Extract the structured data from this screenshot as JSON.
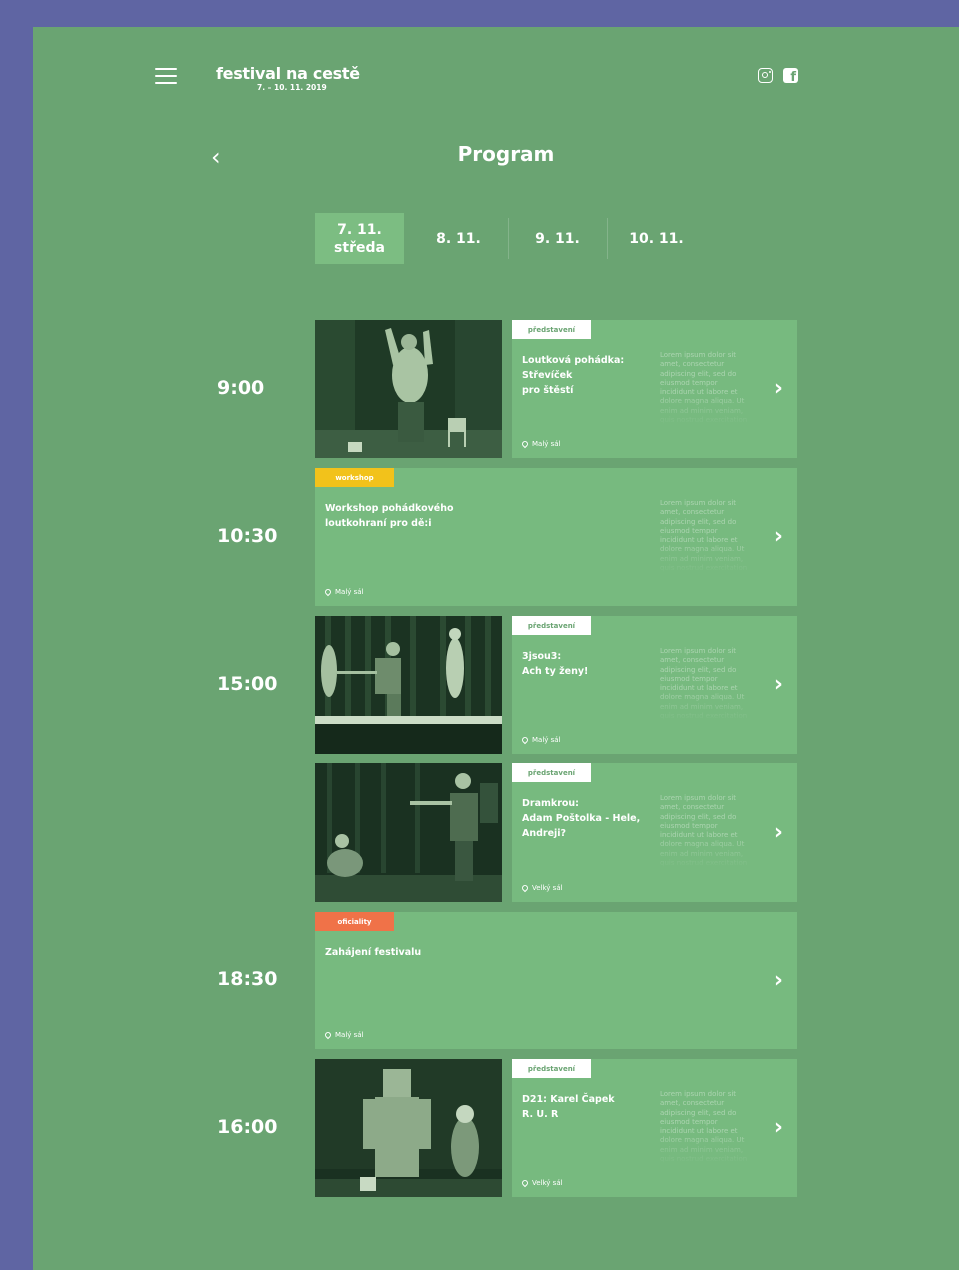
{
  "header": {
    "logo_name": "festival na cestě",
    "logo_dates": "7. – 10. 11. 2019",
    "menu_icon": "hamburger-menu-icon",
    "social": [
      "instagram-icon",
      "facebook-icon"
    ],
    "facebook_glyph": "f"
  },
  "page": {
    "back_glyph": "‹",
    "title": "Program"
  },
  "tabs": [
    {
      "label": "7. 11.\nstředa",
      "active": true
    },
    {
      "label": "8. 11."
    },
    {
      "label": "9. 11."
    },
    {
      "label": "10. 11."
    }
  ],
  "events": [
    {
      "time": "9:00",
      "badge": "představení",
      "title": "Loutková pohádka:\nStřevíček\npro štěstí",
      "description": "Lorem ipsum dolor sit amet, consectetur adipiscing elit, sed do eiusmod tempor incididunt ut labore et dolore magna aliqua. Ut enim ad minim veniam, quis nostrud exercitation ullamco laboris nisi ut",
      "venue": "Malý sál",
      "arrow": "›"
    },
    {
      "time": "10:30",
      "badge": "workshop",
      "title": "Workshop pohádkového\nloutkohraní pro dě:i",
      "description": "Lorem ipsum dolor sit amet, consectetur adipiscing elit, sed do eiusmod tempor incididunt ut labore et dolore magna aliqua. Ut enim ad minim veniam, quis nostrud exercitation ullamco laboris nisi ut",
      "venue": "Malý sál",
      "arrow": "›"
    },
    {
      "time": "15:00",
      "badge": "představení",
      "title": "3jsou3:\nAch ty ženy!",
      "description": "Lorem ipsum dolor sit amet, consectetur adipiscing elit, sed do eiusmod tempor incididunt ut labore et dolore magna aliqua. Ut enim ad minim veniam, quis nostrud exercitation ullamco laboris nisi ut",
      "venue": "Malý sál",
      "arrow": "›"
    },
    {
      "time": "",
      "badge": "představení",
      "title": "Dramkrou:\nAdam Poštolka - Hele,\nAndreji?",
      "description": "Lorem ipsum dolor sit amet, consectetur adipiscing elit, sed do eiusmod tempor incididunt ut labore et dolore magna aliqua. Ut enim ad minim veniam, quis nostrud exercitation ullamco laboris nisi ut",
      "venue": "Velký sál",
      "arrow": "›"
    },
    {
      "time": "18:30",
      "badge": "oficiality",
      "title": "Zahájení festivalu",
      "description": "",
      "venue": "Malý sál",
      "arrow": "›"
    },
    {
      "time": "16:00",
      "badge": "představení",
      "title": "D21: Karel Čapek\nR. U. R",
      "description": "Lorem ipsum dolor sit amet, consectetur adipiscing elit, sed do eiusmod tempor incididunt ut labore et dolore magna aliqua. Ut enim ad minim veniam, quis nostrud exercitation ullamco laboris nisi ut",
      "venue": "Velký sál",
      "arrow": "›"
    }
  ],
  "colors": {
    "frame": "#5f65a3",
    "page": "#6aa472",
    "card": "#77ba7f",
    "badge_workshop": "#f2c21b",
    "badge_official": "#f07248",
    "photo": "#223a28"
  }
}
